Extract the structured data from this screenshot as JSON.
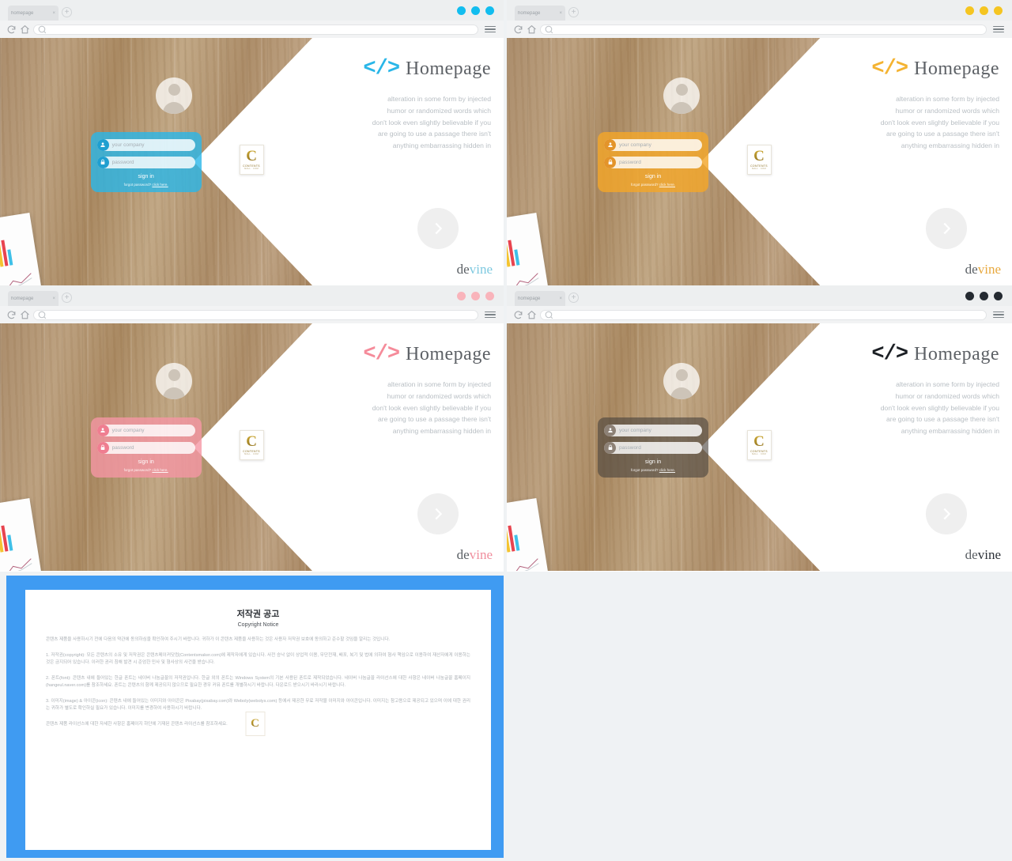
{
  "browser": {
    "tab_label": "homepage",
    "tab_close": "×",
    "new_tab": "+",
    "address_value": "",
    "address_placeholder": ""
  },
  "panels": [
    {
      "id": "panel-cyan",
      "accent": "#29b6e8",
      "accent_soft": "#5ec8ee",
      "dot_color": "#12bdef",
      "card_bg": "rgba(41,182,232,0.80)",
      "badge_bg": "#1f9fd0",
      "devine_accent": "#7ec9e0"
    },
    {
      "id": "panel-amber",
      "accent": "#f4b331",
      "accent_soft": "#f8c95f",
      "dot_color": "#f5c521",
      "card_bg": "rgba(243,166,42,0.82)",
      "badge_bg": "#e3942a",
      "devine_accent": "#e8a93f"
    },
    {
      "id": "panel-pink",
      "accent": "#f58b9a",
      "accent_soft": "#f8a9b4",
      "dot_color": "#f9b4bb",
      "card_bg": "rgba(245,150,164,0.80)",
      "badge_bg": "#ef7e90",
      "devine_accent": "#f08e9d"
    },
    {
      "id": "panel-dark",
      "accent": "#1b1f24",
      "accent_soft": "#5a5550",
      "dot_color": "#242a31",
      "card_bg": "rgba(74,68,61,0.62)",
      "badge_bg": "#8d8176",
      "devine_accent": "#2b3037"
    }
  ],
  "hero": {
    "code_glyph": "</>",
    "brand_name": "Homepage",
    "paragraph_lines": [
      "alteration in some form by injected",
      "humor or randomized words which",
      "don't look even slightly believable if you",
      "are going to use a passage there isn't",
      "anything embarrassing hidden in"
    ],
    "footer_brand_a": "de",
    "footer_brand_b": "vine",
    "logo_letter": "C",
    "logo_name": "CONTENTS",
    "logo_tagline": "MALL . COM"
  },
  "login": {
    "company_placeholder": "your company",
    "password_placeholder": "password",
    "signin_label": "sign in",
    "forgot_text": "forgot password? ",
    "forgot_link": "click here."
  },
  "copyright": {
    "title": "저작권 공고",
    "subtitle": "Copyright Notice",
    "intro": "콘텐츠 제품을 사용하시기 전에 다음의 약관에 동의하심을 확인하여 주시기 바랍니다. 귀하가 이 콘텐츠 제품을 사용하는 것은 사용자 저작권 보호에 동의하고 준수할 것임을 알리는 것입니다.",
    "section1": "1. 저작권(copyright): 모든 콘텐츠의 소유 및 저작권은 콘텐츠메이커닷컴(Contentsmaker.com)에 제작자에게 있습니다. 사전 승낙 없이 상업적 이용, 무단전재, 배포, 복기 및 법에 의하여 형사 책임으로 이용하여 재산자에게 이용하는 것은 금지되어 있습니다. 이러한 권리 침해 발견 시 준엄한 민사 및 형사상의 사건을 받습니다.",
    "section2": "2. 폰트(font): 콘텐츠 내에 들어있는 한글 폰트는 네이버 나눔글꼴의 저작권입니다. 한글 외의 폰트는 Windows System의 기본 사용된 폰트로 제작되었습니다. 네이버 나눔글꼴 라이선스에 대한 사항은 네이버 나눔글꼴 홈페이지(hangeul.naver.com)를 참조하세요. 폰트는 콘텐츠의 함께 제공되지 않으므로 필요한 경우 커뮤 폰트를 개별하시기 바랍니다. 다운로드 받으시기 바라시기 바랍니다.",
    "section3": "3. 이미지(image) & 아이콘(icon): 콘텐츠 내에 들어있는 이미지와 아이콘은 Pixabay(pixabay.com)와 Weboly(webolys.com) 등에서 제공한 무료 저작물 이미지와 아이콘입니다. 이미지는 참고용으로 제공되고 있으며 이에 대한 권리는 귀하가 별도로 확인하실 필요가 있습니다. 이미지를 변경하여 사용하시기 바랍니다.",
    "outro": "콘텐츠 제품 라이선스에 대한 자세한 사항은 홈페이지 하단에 기재된 콘텐츠 라이선스를 참조하세요."
  }
}
